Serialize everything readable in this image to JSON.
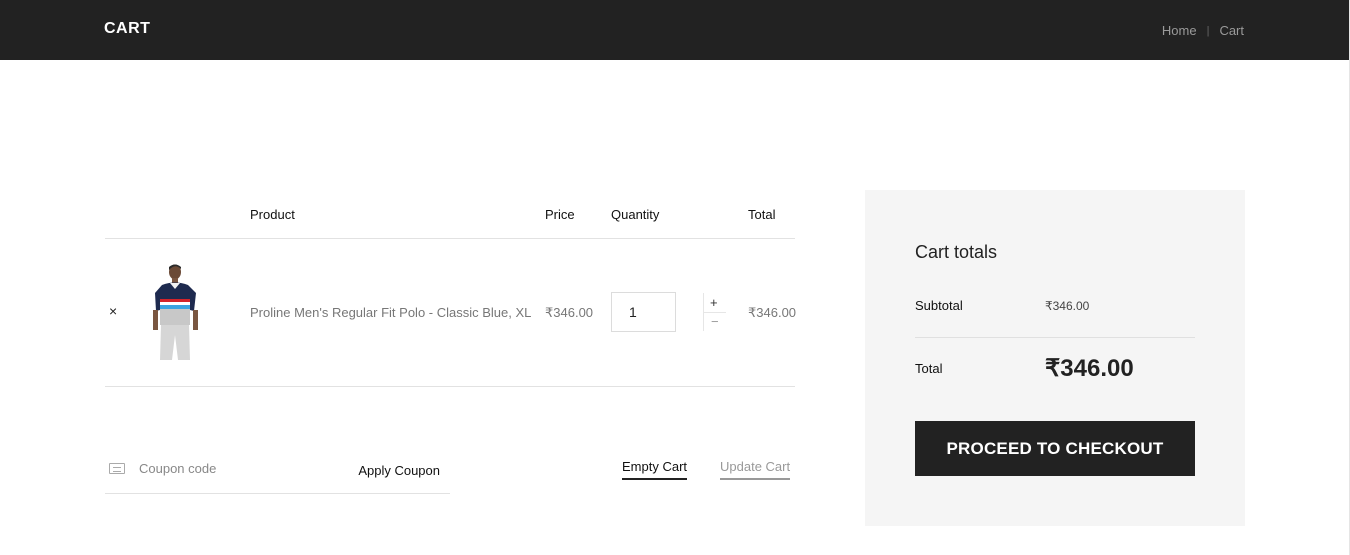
{
  "header": {
    "title": "CART",
    "breadcrumb": {
      "home": "Home",
      "separator": "|",
      "current": "Cart"
    }
  },
  "table": {
    "columns": {
      "product": "Product",
      "price": "Price",
      "quantity": "Quantity",
      "total": "Total"
    },
    "items": [
      {
        "remove": "×",
        "name": "Proline Men's Regular Fit Polo - Classic Blue, XL",
        "price": "₹346.00",
        "quantity": "1",
        "total": "₹346.00"
      }
    ],
    "stepper": {
      "plus": "+",
      "minus": "−"
    }
  },
  "coupon": {
    "placeholder": "Coupon code",
    "apply_label": "Apply Coupon"
  },
  "actions": {
    "empty_cart": "Empty Cart",
    "update_cart": "Update Cart"
  },
  "totals": {
    "title": "Cart totals",
    "subtotal_label": "Subtotal",
    "subtotal_value": "₹346.00",
    "total_label": "Total",
    "total_value": "₹346.00",
    "checkout_label": "PROCEED TO CHECKOUT"
  },
  "colors": {
    "header_bg": "#222222",
    "panel_bg": "#f5f5f5",
    "button_bg": "#222222"
  }
}
